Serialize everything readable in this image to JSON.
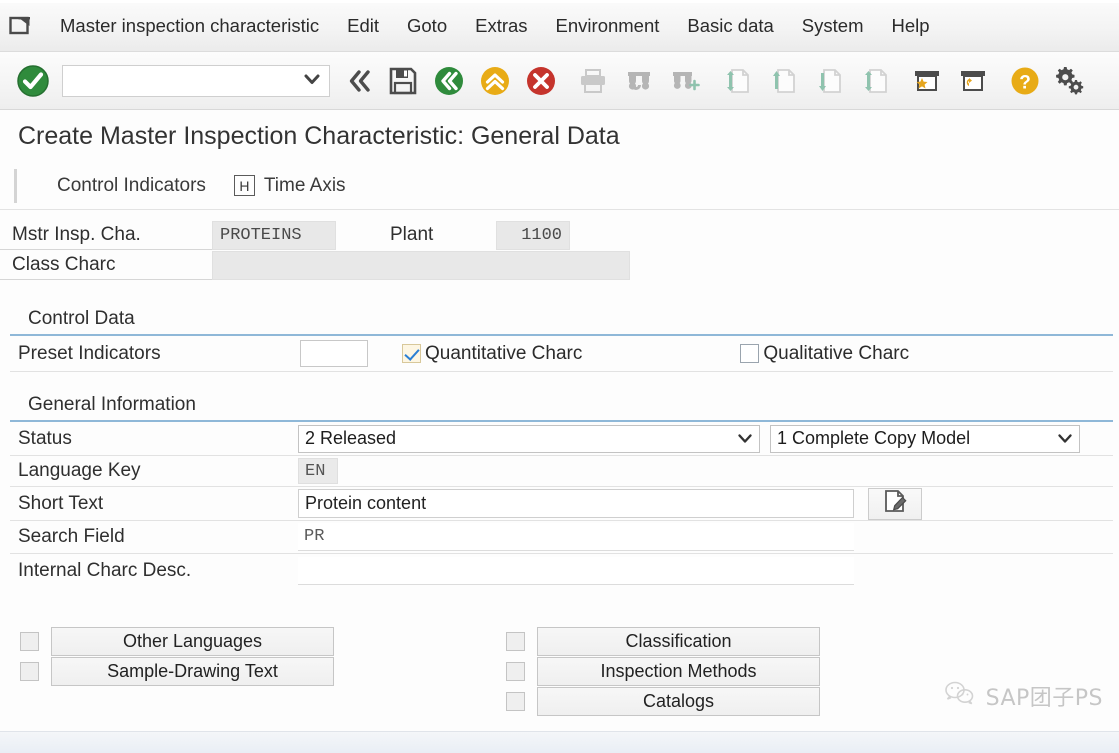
{
  "menubar": {
    "system_icon": "system-menu-icon",
    "items": [
      {
        "label": "Master inspection characteristic",
        "accel": "M"
      },
      {
        "label": "Edit",
        "accel": "E"
      },
      {
        "label": "Goto",
        "accel": "o"
      },
      {
        "label": "Extras",
        "accel": "a"
      },
      {
        "label": "Environment",
        "accel": "v"
      },
      {
        "label": "Basic data",
        "accel": "d"
      },
      {
        "label": "System",
        "accel": "y"
      },
      {
        "label": "Help",
        "accel": "H"
      }
    ]
  },
  "toolbar": {
    "command_field_value": "",
    "command_field_placeholder": "",
    "buttons": [
      {
        "name": "enter-button",
        "icon": "green-check-circle-icon",
        "title": "Enter"
      },
      {
        "name": "back-button",
        "icon": "double-chevron-left-icon",
        "title": "Back"
      },
      {
        "name": "save-button",
        "icon": "floppy-disk-icon",
        "title": "Save"
      },
      {
        "name": "back-green-button",
        "icon": "green-back-circle-icon",
        "title": "Back"
      },
      {
        "name": "exit-button",
        "icon": "yellow-up-circle-icon",
        "title": "Exit"
      },
      {
        "name": "cancel-button",
        "icon": "red-cross-circle-icon",
        "title": "Cancel"
      },
      {
        "name": "print-button",
        "icon": "printer-icon",
        "title": "Print"
      },
      {
        "name": "find-button",
        "icon": "binoculars-icon",
        "title": "Find"
      },
      {
        "name": "find-next-button",
        "icon": "binoculars-plus-icon",
        "title": "Find Next"
      },
      {
        "name": "first-page-button",
        "icon": "page-first-icon",
        "title": "First Page"
      },
      {
        "name": "previous-page-button",
        "icon": "page-up-icon",
        "title": "Previous Page"
      },
      {
        "name": "next-page-button",
        "icon": "page-down-icon",
        "title": "Next Page"
      },
      {
        "name": "last-page-button",
        "icon": "page-last-icon",
        "title": "Last Page"
      },
      {
        "name": "create-session-button",
        "icon": "window-star-icon",
        "title": "Create Session"
      },
      {
        "name": "create-shortcut-button",
        "icon": "window-shortcut-icon",
        "title": "Create Shortcut"
      },
      {
        "name": "help-button",
        "icon": "yellow-question-circle-icon",
        "title": "Help"
      },
      {
        "name": "customize-button",
        "icon": "gears-icon",
        "title": "Customize Local Layout"
      }
    ]
  },
  "page": {
    "title": "Create Master Inspection Characteristic: General Data"
  },
  "tabstrip": {
    "control_indicators_label": "Control Indicators",
    "time_axis_label": "Time Axis",
    "time_axis_icon_glyph": "H"
  },
  "header": {
    "mstr_insp_cha_label": "Mstr Insp. Cha.",
    "mstr_insp_cha_value": "PROTEINS",
    "plant_label": "Plant",
    "plant_value": "1100",
    "class_charc_label": "Class Charc",
    "class_charc_value": ""
  },
  "control_data": {
    "section_title": "Control Data",
    "preset_indicators_label": "Preset Indicators",
    "preset_indicators_value": "",
    "quantitative_label": "Quantitative Charc",
    "quantitative_checked": true,
    "qualitative_label": "Qualitative Charc",
    "qualitative_checked": false
  },
  "general_information": {
    "section_title": "General Information",
    "rows": {
      "status_label": "Status",
      "status_value": "2 Released",
      "copy_model_value": "1 Complete Copy Model",
      "language_key_label": "Language Key",
      "language_key_value": "EN",
      "short_text_label": "Short Text",
      "short_text_value": "Protein content",
      "short_text_edit_icon": "document-pencil-icon",
      "search_field_label": "Search Field",
      "search_field_value": "PR",
      "internal_charc_desc_label": "Internal Charc Desc.",
      "internal_charc_desc_value": ""
    }
  },
  "action_buttons": {
    "left": [
      {
        "label": "Other Languages",
        "checked": false
      },
      {
        "label": "Sample-Drawing Text",
        "checked": false
      }
    ],
    "right": [
      {
        "label": "Classification",
        "checked": false
      },
      {
        "label": "Inspection Methods",
        "checked": false
      },
      {
        "label": "Catalogs",
        "checked": false
      }
    ]
  },
  "watermark": {
    "text": "SAP团子PS",
    "logo_icon": "wechat-logo-icon"
  },
  "colors": {
    "accent_blue": "#8fb8d8",
    "check_blue": "#2a7fd4",
    "green": "#2e8b3d",
    "yellow": "#e8a800",
    "red": "#c8342b",
    "readonly_field": "#e8e8e8"
  }
}
